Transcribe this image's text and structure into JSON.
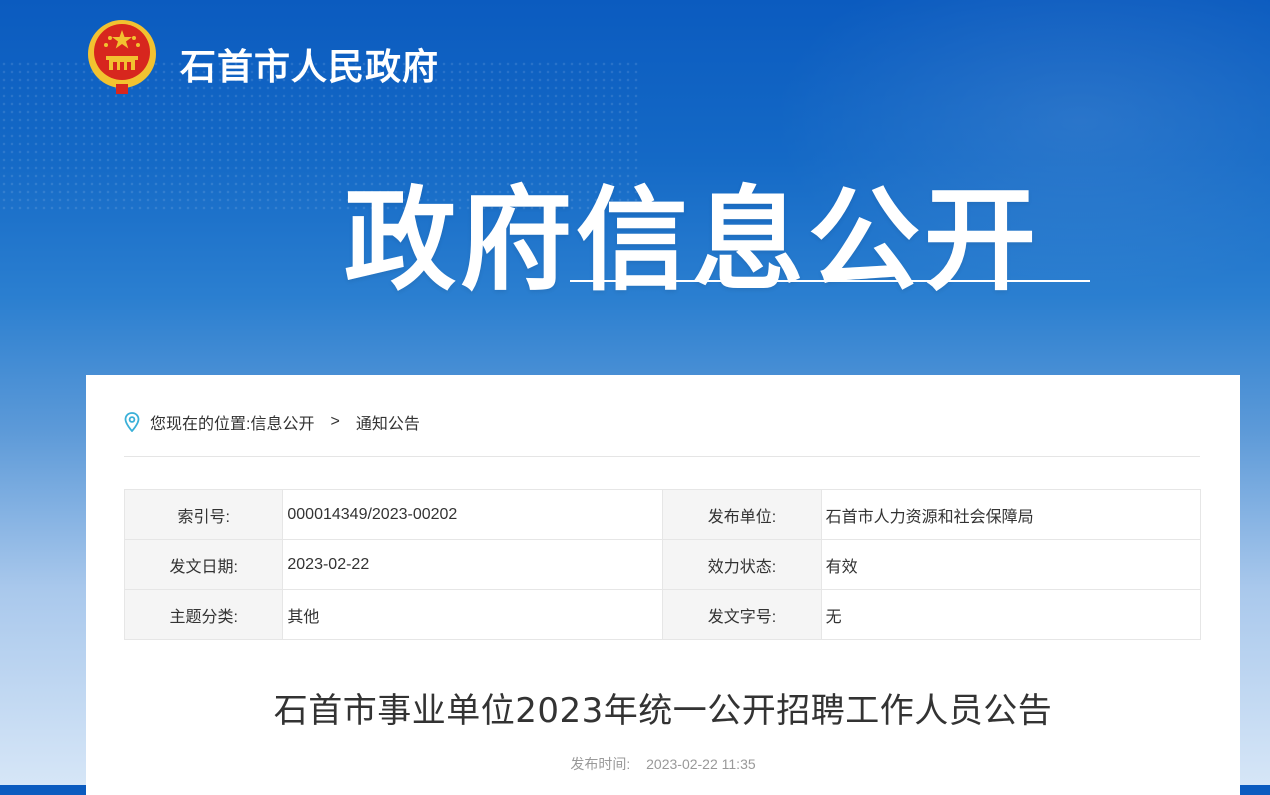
{
  "header": {
    "site_title": "石首市人民政府",
    "hero_title": "政府信息公开"
  },
  "breadcrumb": {
    "prefix": "您现在的位置:",
    "items": [
      "信息公开",
      "通知公告"
    ],
    "separator": ">"
  },
  "meta": {
    "rows": [
      {
        "k1": "索引号:",
        "v1": "000014349/2023-00202",
        "k2": "发布单位:",
        "v2": "石首市人力资源和社会保障局"
      },
      {
        "k1": "发文日期:",
        "v1": "2023-02-22",
        "k2": "效力状态:",
        "v2": "有效"
      },
      {
        "k1": "主题分类:",
        "v1": "其他",
        "k2": "发文字号:",
        "v2": "无"
      }
    ]
  },
  "article": {
    "title": "石首市事业单位2023年统一公开招聘工作人员公告",
    "pub_label": "发布时间:",
    "pub_time": "2023-02-22 11:35"
  },
  "colors": {
    "banner_blue": "#0b5bbf",
    "accent_cyan": "#3ab0d8",
    "emblem_red": "#d7261e",
    "emblem_gold": "#f2c230"
  },
  "icons": [
    "national-emblem-icon",
    "location-pin-icon"
  ]
}
